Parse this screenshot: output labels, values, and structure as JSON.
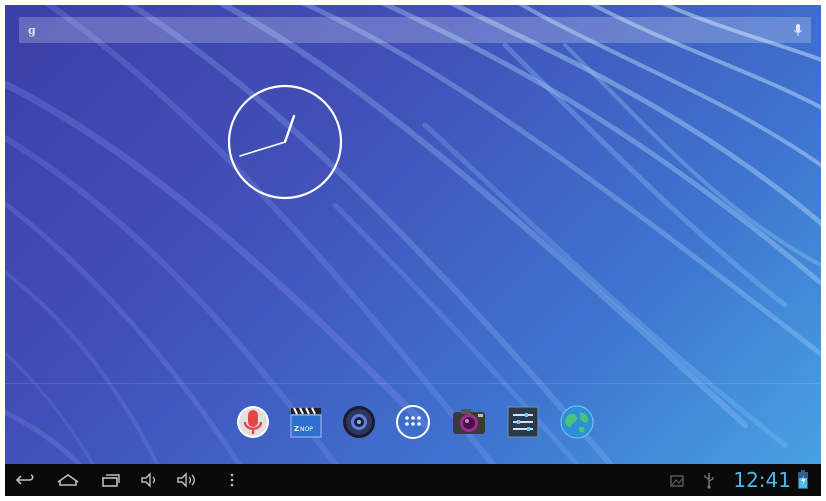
{
  "status": {
    "time": "12:41"
  },
  "dock": {
    "apps": [
      {
        "icon": "voice-search-icon"
      },
      {
        "icon": "video-player-icon"
      },
      {
        "icon": "music-player-icon"
      },
      {
        "icon": "all-apps-icon"
      },
      {
        "icon": "camera-icon"
      },
      {
        "icon": "settings-icon"
      },
      {
        "icon": "browser-icon"
      }
    ]
  },
  "navbar": {
    "buttons": [
      {
        "icon": "back-icon"
      },
      {
        "icon": "home-icon"
      },
      {
        "icon": "recent-apps-icon"
      },
      {
        "icon": "volume-down-icon"
      },
      {
        "icon": "volume-up-icon"
      },
      {
        "icon": "menu-icon"
      }
    ],
    "status_icons": [
      "gallery-icon",
      "usb-icon",
      "battery-icon"
    ]
  },
  "colors": {
    "clock_text": "#4fb8e8",
    "navbar": "#0a0a0a"
  }
}
